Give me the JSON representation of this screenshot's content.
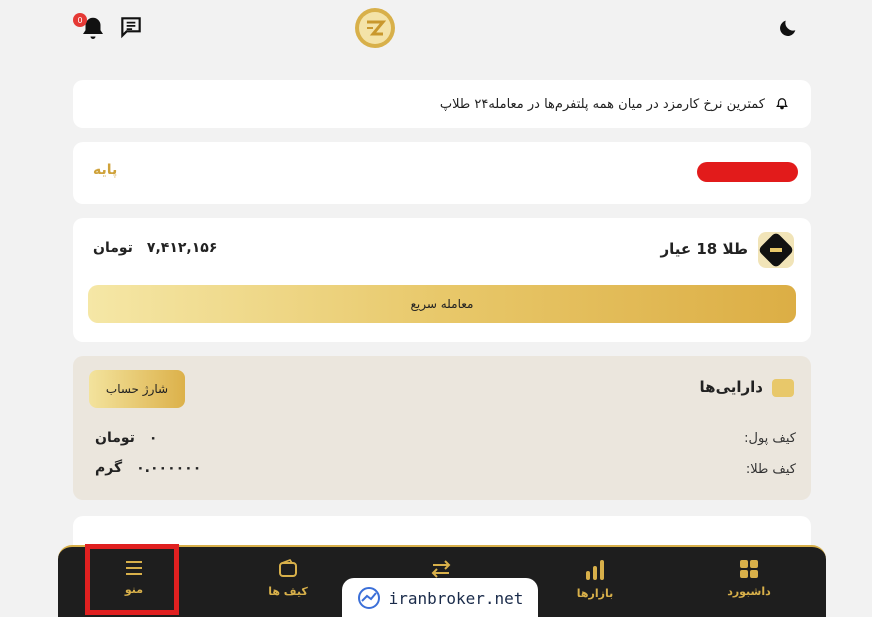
{
  "header": {
    "notification_count": "0"
  },
  "announcement": {
    "text": "کمترین نرخ کارمزد در میان همه پلتفرم‌ها در معامله۲۴ طلاپ"
  },
  "level": {
    "label": "پایه",
    "bar_color": "#e21b1b"
  },
  "gold": {
    "title": "طلا 18 عیار",
    "price": "۷,۴۱۲,۱۵۶",
    "currency": "تومان",
    "quick_trade_label": "معامله سریع"
  },
  "assets": {
    "title": "دارایی‌ها",
    "charge_label": "شارژ حساب",
    "wallet_label": "کیف پول:",
    "wallet_value": "۰",
    "wallet_unit": "تومان",
    "gold_wallet_label": "کیف طلا:",
    "gold_wallet_value": "۰.۰۰۰۰۰۰",
    "gold_wallet_unit": "گرم"
  },
  "nav": {
    "items": [
      {
        "label": "داشبورد",
        "icon": "grid-icon"
      },
      {
        "label": "بازارها",
        "icon": "bar-chart-icon"
      },
      {
        "label": "",
        "icon": "swap-icon"
      },
      {
        "label": "کیف ها",
        "icon": "wallet-icon"
      },
      {
        "label": "منو",
        "icon": "menu-icon"
      }
    ]
  },
  "watermark": {
    "text": "iranbroker.net"
  },
  "colors": {
    "accent_gold": "#d8b04a",
    "nav_bg": "#1e1e1e",
    "highlight": "#e02020"
  }
}
